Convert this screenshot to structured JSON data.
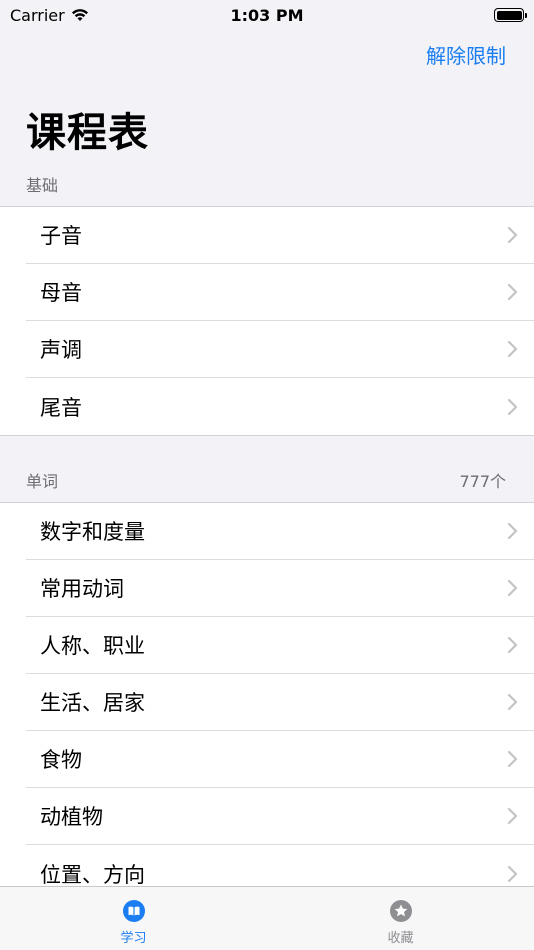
{
  "status_bar": {
    "carrier": "Carrier",
    "time": "1:03 PM"
  },
  "nav": {
    "action_label": "解除限制",
    "title": "课程表"
  },
  "sections": [
    {
      "header": "基础",
      "count": "",
      "items": [
        {
          "label": "子音"
        },
        {
          "label": "母音"
        },
        {
          "label": "声调"
        },
        {
          "label": "尾音"
        }
      ]
    },
    {
      "header": "单词",
      "count": "777个",
      "items": [
        {
          "label": "数字和度量"
        },
        {
          "label": "常用动词"
        },
        {
          "label": "人称、职业"
        },
        {
          "label": "生活、居家"
        },
        {
          "label": "食物"
        },
        {
          "label": "动植物"
        },
        {
          "label": "位置、方向"
        }
      ]
    }
  ],
  "tab_bar": {
    "tabs": [
      {
        "label": "学习",
        "icon": "book-icon",
        "active": true
      },
      {
        "label": "收藏",
        "icon": "star-icon",
        "active": false
      }
    ]
  },
  "colors": {
    "accent": "#1a7ef2",
    "background": "#f2f2f7",
    "inactive": "#8e8e93"
  }
}
